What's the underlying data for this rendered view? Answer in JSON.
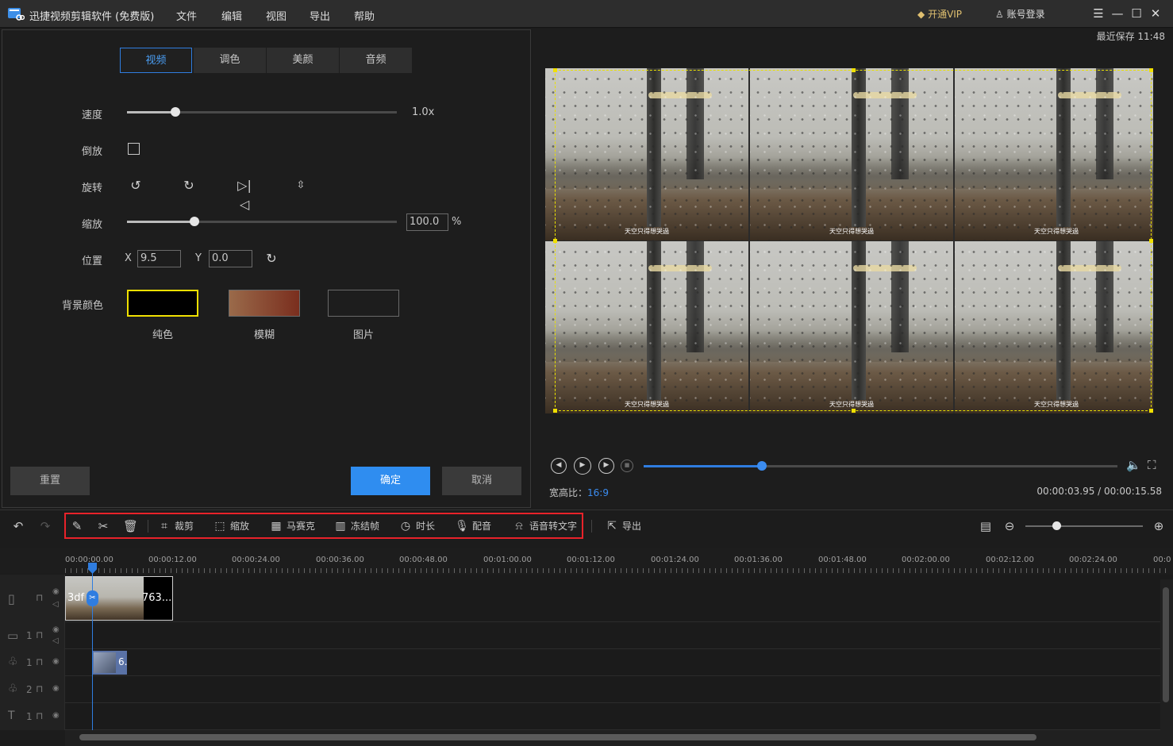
{
  "titlebar": {
    "app_title": "迅捷视频剪辑软件 (免费版)",
    "menu": [
      "文件",
      "编辑",
      "视图",
      "导出",
      "帮助"
    ],
    "vip": "开通VIP",
    "login": "账号登录",
    "window_buttons": [
      "menu-icon",
      "minimize-icon",
      "maximize-icon",
      "close-icon"
    ]
  },
  "panel": {
    "tabs": [
      "视频",
      "调色",
      "美颜",
      "音频"
    ],
    "active_tab": "视频",
    "speed": {
      "label": "速度",
      "value": "1.0x",
      "level": 0.18
    },
    "reverse": {
      "label": "倒放",
      "checked": false
    },
    "rotate": {
      "label": "旋转",
      "buttons": [
        "rotate-left-icon",
        "rotate-right-icon",
        "flip-horizontal-icon",
        "flip-vertical-icon"
      ]
    },
    "zoom": {
      "label": "缩放",
      "value": "100.0",
      "unit": "%",
      "level": 0.25
    },
    "position": {
      "label": "位置",
      "x_label": "X",
      "x": "9.5",
      "y_label": "Y",
      "y": "0.0"
    },
    "bg_color": {
      "label": "背景颜色",
      "options": [
        "纯色",
        "模糊",
        "图片"
      ]
    },
    "reset": "重置",
    "confirm": "确定",
    "cancel": "取消"
  },
  "preview": {
    "last_save": "最近保存 11:48",
    "tile_caption": "天空只得想哭過",
    "aspect_label": "宽高比：",
    "aspect_value": "16:9",
    "time": "00:00:03.95 / 00:00:15.58",
    "progress": 0.25,
    "colors": {
      "accent": "#2f7de0",
      "selection": "#e8e000"
    }
  },
  "toolbar": {
    "items": [
      {
        "name": "裁剪"
      },
      {
        "name": "缩放"
      },
      {
        "name": "马赛克"
      },
      {
        "name": "冻结帧"
      },
      {
        "name": "时长"
      },
      {
        "name": "配音"
      },
      {
        "name": "语音转文字"
      }
    ],
    "export": "导出",
    "highlight_color": "#e8222a"
  },
  "timeline": {
    "ticks": [
      "00:00:00.00",
      "00:00:12.00",
      "00:00:24.00",
      "00:00:36.00",
      "00:00:48.00",
      "00:01:00.00",
      "00:01:12.00",
      "00:01:24.00",
      "00:01:36.00",
      "00:01:48.00",
      "00:02:00.00",
      "00:02:12.00",
      "00:02:24.00",
      "00:0"
    ],
    "track_numbers": [
      "1",
      "1",
      "2",
      "1"
    ],
    "clip_main_left": "3df",
    "clip_main_right": "763...",
    "clip_small_label": "6."
  }
}
